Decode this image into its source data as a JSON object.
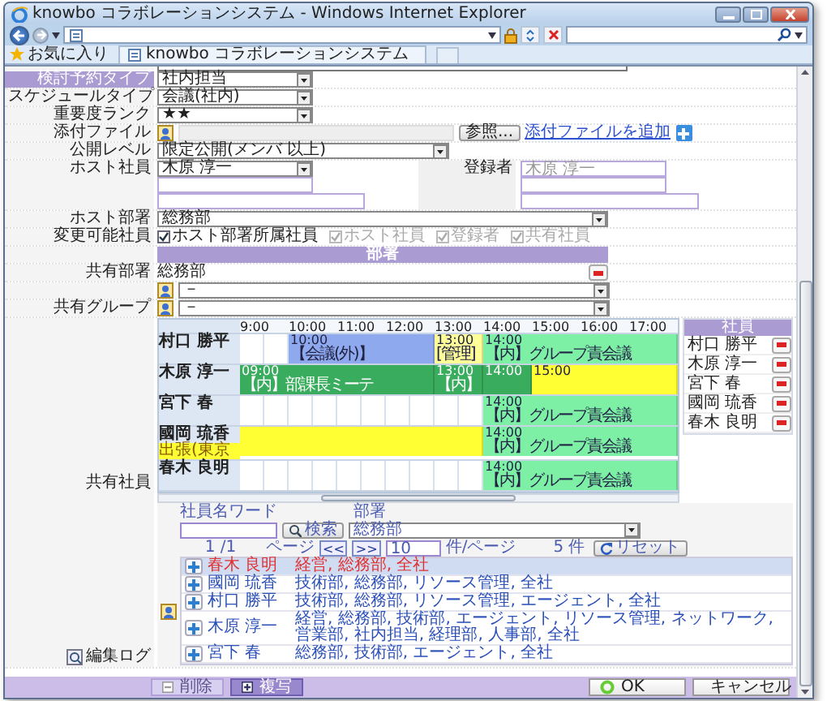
{
  "window": {
    "title": "knowbo コラボレーションシステム - Windows Internet Explorer"
  },
  "browser": {
    "favorites": "お気に入り",
    "tab": "knowbo コラボレーションシステム"
  },
  "fields": [
    {
      "kind": "select",
      "label": "検討予約タイプ",
      "value": "社内担当",
      "selected": true
    },
    {
      "kind": "select",
      "label": "スケジュールタイプ",
      "value": "会議(社内)",
      "selected": false
    },
    {
      "kind": "select",
      "label": "重要度ランク",
      "value": "★★",
      "selected": false
    },
    {
      "kind": "file",
      "label": "添付ファイル",
      "button": "参照...",
      "link": "添付ファイルを追加",
      "selected": false
    },
    {
      "kind": "wideselect",
      "label": "公開レベル",
      "value": "限定公開(メンバ 以上)",
      "selected": false
    },
    {
      "kind": "host",
      "label": "ホスト社員",
      "value": "木原 淳一",
      "registrant_label": "登録者",
      "registrant": "木原 淳一",
      "selected": false
    },
    {
      "kind": "fullselect",
      "label": "ホスト部署",
      "value": "総務部",
      "selected": false
    },
    {
      "kind": "checks",
      "label": "変更可能社員",
      "selected": false,
      "options": [
        {
          "label": "ホスト部署所属社員",
          "checked": true,
          "disabled": false
        },
        {
          "label": "ホスト社員",
          "checked": true,
          "disabled": true
        },
        {
          "label": "登録者",
          "checked": true,
          "disabled": true
        },
        {
          "label": "共有社員",
          "checked": true,
          "disabled": true
        }
      ]
    }
  ],
  "shared": {
    "header": "部署",
    "department_label": "共有部署",
    "department": "総務部",
    "department_select": "－",
    "group_label": "共有グループ",
    "group_select": "－",
    "employee_label": "共有社員"
  },
  "schedule": {
    "times": [
      "9:00",
      "10:00",
      "11:00",
      "12:00",
      "13:00",
      "14:00",
      "15:00",
      "16:00",
      "17:00"
    ],
    "rows": [
      {
        "name": "村口 勝平",
        "events": [
          {
            "kind": "event",
            "time": "10:00",
            "label": "【会議(外)】",
            "color": "#8ea9ee"
          },
          {
            "kind": "event",
            "time": "13:00",
            "label": "[管理]",
            "color": "#ffff99"
          },
          {
            "kind": "event",
            "time": "14:00",
            "label": "【内】グループ責会議",
            "color": "#7ef0a6"
          }
        ]
      },
      {
        "name": "木原 淳一",
        "events": [
          {
            "kind": "event",
            "time": "09:00",
            "label": "【内】部課長ミーテ",
            "color": "#3aac5e"
          },
          {
            "kind": "event",
            "time": "13:00",
            "label": "【内】",
            "color": "#3aac5e"
          },
          {
            "kind": "event",
            "time": "14:00",
            "color": "#3aac5e"
          },
          {
            "kind": "event",
            "time": "15:00",
            "color": "#ffff33"
          }
        ]
      },
      {
        "name": "宮下 春",
        "events": [
          {
            "kind": "event",
            "time": "14:00",
            "label": "【内】グループ責会議",
            "color": "#7ef0a6"
          }
        ]
      },
      {
        "name": "國岡 琉香",
        "note": "出張(東京",
        "events": [
          {
            "kind": "band",
            "color": "#ffff33"
          },
          {
            "kind": "event",
            "time": "14:00",
            "label": "【内】グループ責会議",
            "color": "#7ef0a6"
          }
        ]
      },
      {
        "name": "春木 良明",
        "events": [
          {
            "kind": "event",
            "time": "14:00",
            "label": "【内】グループ責会議",
            "color": "#7ef0a6"
          }
        ]
      }
    ]
  },
  "members": {
    "header": "社員",
    "names": [
      "村口 勝平",
      "木原 淳一",
      "宮下 春",
      "國岡 琉香",
      "春木 良明"
    ]
  },
  "search": {
    "word_label": "社員名ワード",
    "search_button": "検索",
    "department_label": "部署",
    "department": "総務部",
    "page": "1 /1",
    "page_label": "ページ",
    "prev": "<<",
    "next": ">>",
    "per_page": "10",
    "per_page_label": "件/ページ",
    "count": "5 件",
    "reset": "リセット"
  },
  "results": [
    {
      "name": "春木 良明",
      "departments": "経営, 総務部, 全社",
      "selected": true
    },
    {
      "name": "國岡 琉香",
      "departments": "技術部, 総務部, リソース管理, 全社",
      "selected": false
    },
    {
      "name": "村口 勝平",
      "departments": "技術部, 総務部, リソース管理, エージェント, 全社",
      "selected": false
    },
    {
      "name": "木原 淳一",
      "departments": "経営, 総務部, 技術部, エージェント, リソース管理, ネットワーク, 営業部, 社内担当, 経理部, 人事部, 全社",
      "selected": false
    },
    {
      "name": "宮下 春",
      "departments": "総務部, 技術部, エージェント, 全社",
      "selected": false
    }
  ],
  "edit_log": "編集ログ",
  "buttons": [
    {
      "label": "削除",
      "kind": "delete",
      "disabled": true
    },
    {
      "label": "複写",
      "kind": "copy",
      "disabled": false
    },
    {
      "label": "OK",
      "kind": "ok",
      "disabled": false
    },
    {
      "label": "キャンセル",
      "kind": "cancel",
      "disabled": false
    }
  ]
}
